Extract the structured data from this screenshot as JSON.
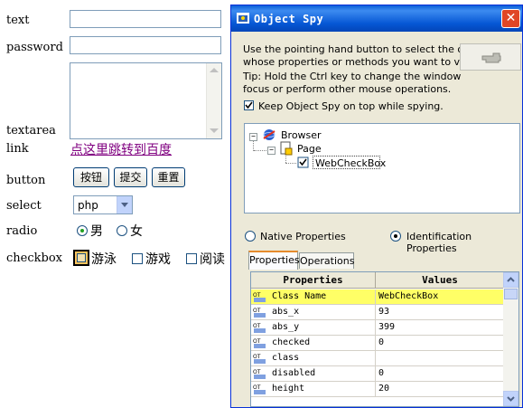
{
  "form": {
    "labels": {
      "text": "text",
      "password": "password",
      "textarea": "textarea",
      "link": "link",
      "button": "button",
      "select": "select",
      "radio": "radio",
      "checkbox": "checkbox"
    },
    "text_value": "",
    "password_value": "",
    "textarea_value": "",
    "link_text": "点这里跳转到百度",
    "buttons": [
      "按钮",
      "提交",
      "重置"
    ],
    "select_value": "php",
    "radios": [
      {
        "label": "男",
        "checked": true
      },
      {
        "label": "女",
        "checked": false
      }
    ],
    "checkboxes": [
      {
        "label": "游泳",
        "checked": false,
        "focused": true
      },
      {
        "label": "游戏",
        "checked": false
      },
      {
        "label": "阅读",
        "checked": false
      }
    ]
  },
  "object_spy": {
    "title": "Object Spy",
    "instructions_1": "Use the pointing hand button to select the object",
    "instructions_2": "whose properties or methods you want to view.",
    "tip_1": "Tip: Hold the Ctrl key to change the window",
    "tip_2": "focus or perform other mouse operations.",
    "keep_on_top": "Keep Object Spy on top while spying.",
    "keep_on_top_checked": true,
    "tree": [
      {
        "label": "Browser",
        "level": 0
      },
      {
        "label": "Page",
        "level": 1
      },
      {
        "label": "WebCheckBox",
        "level": 2
      }
    ],
    "native_properties": "Native Properties",
    "identification_properties": "Identification Properties",
    "properties_mode": "identification",
    "tabs": [
      "Properties",
      "Operations"
    ],
    "active_tab": "Properties",
    "grid_headers": [
      "Properties",
      "Values"
    ],
    "grid_rows": [
      {
        "name": "Class Name",
        "value": "WebCheckBox",
        "selected": true
      },
      {
        "name": "abs_x",
        "value": "93"
      },
      {
        "name": "abs_y",
        "value": "399"
      },
      {
        "name": "checked",
        "value": "0"
      },
      {
        "name": "class",
        "value": ""
      },
      {
        "name": "disabled",
        "value": "0"
      },
      {
        "name": "height",
        "value": "20"
      }
    ]
  },
  "colors": {
    "title_bar": "#0a5fd8",
    "link": "#800080",
    "selected_row": "#ffff66",
    "window_face": "#ece9d8"
  }
}
